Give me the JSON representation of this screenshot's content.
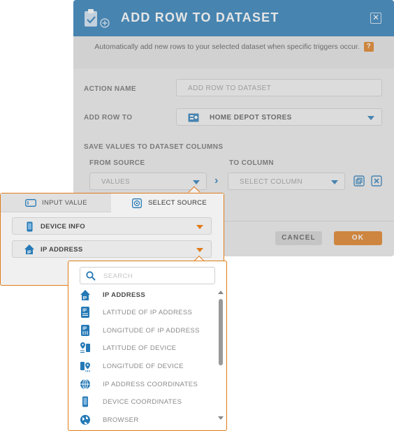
{
  "dialog": {
    "title": "ADD ROW TO DATASET",
    "subtitle": "Automatically add new rows to your selected dataset when specific triggers occur.",
    "help": "?",
    "close_glyph": "✕",
    "action_name_label": "ACTION NAME",
    "action_name_placeholder": "ADD ROW TO DATASET",
    "add_row_to_label": "ADD ROW TO",
    "add_row_to_value": "HOME DEPOT STORES",
    "save_values_label": "SAVE VALUES TO DATASET COLUMNS",
    "from_source_label": "FROM SOURCE",
    "to_column_label": "TO COLUMN",
    "from_source_value": "VALUES",
    "to_column_value": "SELECT COLUMN",
    "arrow_glyph": "›",
    "cancel_label": "CANCEL",
    "ok_label": "OK"
  },
  "source_popup": {
    "tabs": [
      {
        "label": "INPUT VALUE",
        "icon": "text-field-icon"
      },
      {
        "label": "SELECT SOURCE",
        "icon": "source-target-icon"
      }
    ],
    "active_tab": "SELECT SOURCE",
    "category_value": "DEVICE INFO",
    "field_value": "IP ADDRESS"
  },
  "ip_dropdown": {
    "search_placeholder": "SEARCH",
    "options": [
      {
        "label": "IP ADDRESS",
        "icon": "ip-house-icon"
      },
      {
        "label": "LATITUDE OF IP ADDRESS",
        "icon": "ip-latitude-icon"
      },
      {
        "label": "LONGITUDE OF IP ADDRESS",
        "icon": "ip-longitude-icon"
      },
      {
        "label": "LATITUDE OF DEVICE",
        "icon": "device-latitude-icon"
      },
      {
        "label": "LONGITUDE OF DEVICE",
        "icon": "device-longitude-icon"
      },
      {
        "label": "IP ADDRESS COORDINATES",
        "icon": "globe-grid-icon"
      },
      {
        "label": "DEVICE COORDINATES",
        "icon": "phone-icon"
      },
      {
        "label": "BROWSER",
        "icon": "globe-icon"
      }
    ]
  },
  "colors": {
    "header_blue": "#2579b6",
    "accent_orange": "#e07b1a"
  }
}
